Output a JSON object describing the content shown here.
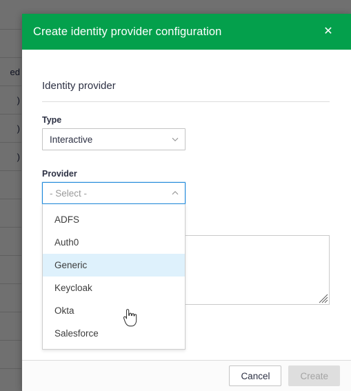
{
  "background": {
    "rows": [
      {
        "text": ""
      },
      {
        "text": "ed"
      },
      {
        "text": ")"
      },
      {
        "text": ")"
      },
      {
        "text": ")"
      },
      {
        "text": ""
      },
      {
        "text": ""
      },
      {
        "text": ""
      },
      {
        "text": ""
      },
      {
        "text": ""
      },
      {
        "text": ""
      },
      {
        "text": ""
      }
    ]
  },
  "modal": {
    "title": "Create identity provider configuration",
    "close_label": "✕",
    "section": {
      "heading": "Identity provider"
    },
    "fields": {
      "type": {
        "label": "Type",
        "value": "Interactive",
        "caret": "chevron-down-icon"
      },
      "provider": {
        "label": "Provider",
        "value": "- Select -",
        "is_placeholder": true,
        "caret": "chevron-up-icon",
        "options": [
          "ADFS",
          "Auth0",
          "Generic",
          "Keycloak",
          "Okta",
          "Salesforce"
        ],
        "highlighted_option": "Generic"
      },
      "notes": {
        "value": "",
        "placeholder": ""
      }
    },
    "footer": {
      "cancel_label": "Cancel",
      "create_label": "Create",
      "create_disabled": true
    }
  },
  "colors": {
    "header_green": "#04a04c",
    "focus_blue": "#1a86d9",
    "highlight_blue": "#def1fc",
    "scrim": "rgba(0,0,0,0.56)"
  }
}
